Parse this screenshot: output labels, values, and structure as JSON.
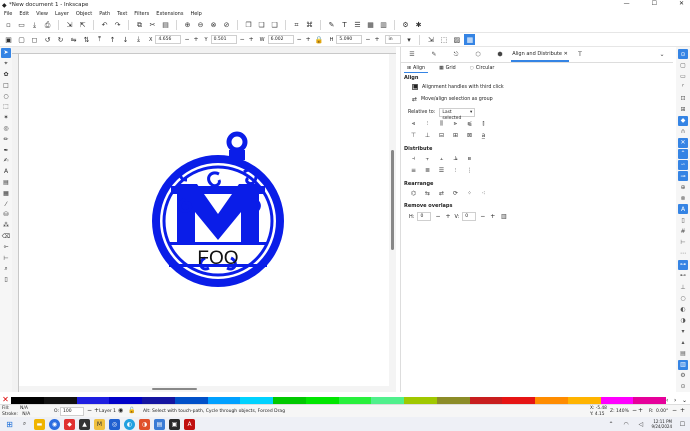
{
  "window": {
    "title": "*New document 1 - Inkscape"
  },
  "menu": [
    "File",
    "Edit",
    "View",
    "Layer",
    "Object",
    "Path",
    "Text",
    "Filters",
    "Extensions",
    "Help"
  ],
  "toolbar2": {
    "x": "4.656",
    "y": "0.501",
    "w": "6.002",
    "h": "5.090",
    "unit": "in"
  },
  "design": {
    "text": "FOO",
    "color": "#0a1de8"
  },
  "panel": {
    "active_tab": "Align and Distribute",
    "subtabs": [
      "Align",
      "Grid",
      "Circular"
    ],
    "align_label": "Align",
    "chk1": "Alignment handles with third click",
    "chk2": "Move/align selection as group",
    "relative_label": "Relative to:",
    "relative_value": "Last selected",
    "distribute_label": "Distribute",
    "rearrange_label": "Rearrange",
    "remove_overlaps_label": "Remove overlaps",
    "h_label": "H:",
    "h_val": "0",
    "v_label": "V:",
    "v_val": "0"
  },
  "palette": [
    "#000000",
    "#111111",
    "#1e1ee0",
    "#0000c8",
    "#1414a0",
    "#0050c8",
    "#00a0ff",
    "#00d2ff",
    "#00c800",
    "#00e600",
    "#28f03c",
    "#50f08c",
    "#a0c800",
    "#8c8c28",
    "#c81e1e",
    "#e61414",
    "#ff8c00",
    "#ffb400",
    "#ff00ff",
    "#e6009a"
  ],
  "status": {
    "fill_label": "Fill:",
    "fill_val": "N/A",
    "stroke_label": "Stroke:",
    "stroke_val": "N/A",
    "opacity_label": "O:",
    "opacity_val": "100",
    "layer": "Layer 1",
    "message": "Alt: Select with touch-path, Cycle through objects, Forced Drag",
    "x_label": "X:",
    "x_val": "-5.48",
    "y_label": "Y:",
    "y_val": "4.15",
    "zoom_label": "Z:",
    "zoom_val": "140%",
    "rot_label": "R:",
    "rot_val": "0.00°"
  },
  "taskbar": {
    "time": "12:11 PM",
    "date": "9/24/2024"
  }
}
